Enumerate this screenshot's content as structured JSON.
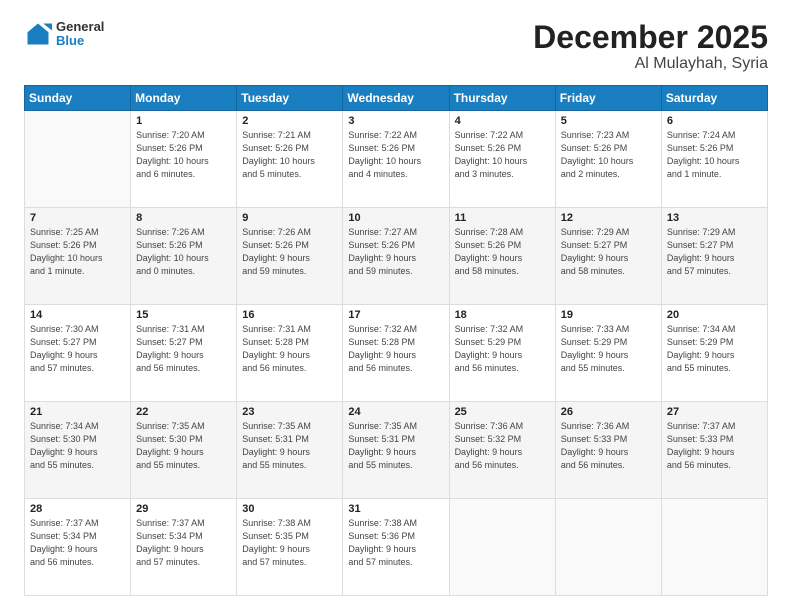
{
  "header": {
    "logo_line1": "General",
    "logo_line2": "Blue",
    "title": "December 2025",
    "subtitle": "Al Mulayhah, Syria"
  },
  "calendar": {
    "days_of_week": [
      "Sunday",
      "Monday",
      "Tuesday",
      "Wednesday",
      "Thursday",
      "Friday",
      "Saturday"
    ],
    "weeks": [
      [
        {
          "day": "",
          "info": ""
        },
        {
          "day": "1",
          "info": "Sunrise: 7:20 AM\nSunset: 5:26 PM\nDaylight: 10 hours\nand 6 minutes."
        },
        {
          "day": "2",
          "info": "Sunrise: 7:21 AM\nSunset: 5:26 PM\nDaylight: 10 hours\nand 5 minutes."
        },
        {
          "day": "3",
          "info": "Sunrise: 7:22 AM\nSunset: 5:26 PM\nDaylight: 10 hours\nand 4 minutes."
        },
        {
          "day": "4",
          "info": "Sunrise: 7:22 AM\nSunset: 5:26 PM\nDaylight: 10 hours\nand 3 minutes."
        },
        {
          "day": "5",
          "info": "Sunrise: 7:23 AM\nSunset: 5:26 PM\nDaylight: 10 hours\nand 2 minutes."
        },
        {
          "day": "6",
          "info": "Sunrise: 7:24 AM\nSunset: 5:26 PM\nDaylight: 10 hours\nand 1 minute."
        }
      ],
      [
        {
          "day": "7",
          "info": "Sunrise: 7:25 AM\nSunset: 5:26 PM\nDaylight: 10 hours\nand 1 minute."
        },
        {
          "day": "8",
          "info": "Sunrise: 7:26 AM\nSunset: 5:26 PM\nDaylight: 10 hours\nand 0 minutes."
        },
        {
          "day": "9",
          "info": "Sunrise: 7:26 AM\nSunset: 5:26 PM\nDaylight: 9 hours\nand 59 minutes."
        },
        {
          "day": "10",
          "info": "Sunrise: 7:27 AM\nSunset: 5:26 PM\nDaylight: 9 hours\nand 59 minutes."
        },
        {
          "day": "11",
          "info": "Sunrise: 7:28 AM\nSunset: 5:26 PM\nDaylight: 9 hours\nand 58 minutes."
        },
        {
          "day": "12",
          "info": "Sunrise: 7:29 AM\nSunset: 5:27 PM\nDaylight: 9 hours\nand 58 minutes."
        },
        {
          "day": "13",
          "info": "Sunrise: 7:29 AM\nSunset: 5:27 PM\nDaylight: 9 hours\nand 57 minutes."
        }
      ],
      [
        {
          "day": "14",
          "info": "Sunrise: 7:30 AM\nSunset: 5:27 PM\nDaylight: 9 hours\nand 57 minutes."
        },
        {
          "day": "15",
          "info": "Sunrise: 7:31 AM\nSunset: 5:27 PM\nDaylight: 9 hours\nand 56 minutes."
        },
        {
          "day": "16",
          "info": "Sunrise: 7:31 AM\nSunset: 5:28 PM\nDaylight: 9 hours\nand 56 minutes."
        },
        {
          "day": "17",
          "info": "Sunrise: 7:32 AM\nSunset: 5:28 PM\nDaylight: 9 hours\nand 56 minutes."
        },
        {
          "day": "18",
          "info": "Sunrise: 7:32 AM\nSunset: 5:29 PM\nDaylight: 9 hours\nand 56 minutes."
        },
        {
          "day": "19",
          "info": "Sunrise: 7:33 AM\nSunset: 5:29 PM\nDaylight: 9 hours\nand 55 minutes."
        },
        {
          "day": "20",
          "info": "Sunrise: 7:34 AM\nSunset: 5:29 PM\nDaylight: 9 hours\nand 55 minutes."
        }
      ],
      [
        {
          "day": "21",
          "info": "Sunrise: 7:34 AM\nSunset: 5:30 PM\nDaylight: 9 hours\nand 55 minutes."
        },
        {
          "day": "22",
          "info": "Sunrise: 7:35 AM\nSunset: 5:30 PM\nDaylight: 9 hours\nand 55 minutes."
        },
        {
          "day": "23",
          "info": "Sunrise: 7:35 AM\nSunset: 5:31 PM\nDaylight: 9 hours\nand 55 minutes."
        },
        {
          "day": "24",
          "info": "Sunrise: 7:35 AM\nSunset: 5:31 PM\nDaylight: 9 hours\nand 55 minutes."
        },
        {
          "day": "25",
          "info": "Sunrise: 7:36 AM\nSunset: 5:32 PM\nDaylight: 9 hours\nand 56 minutes."
        },
        {
          "day": "26",
          "info": "Sunrise: 7:36 AM\nSunset: 5:33 PM\nDaylight: 9 hours\nand 56 minutes."
        },
        {
          "day": "27",
          "info": "Sunrise: 7:37 AM\nSunset: 5:33 PM\nDaylight: 9 hours\nand 56 minutes."
        }
      ],
      [
        {
          "day": "28",
          "info": "Sunrise: 7:37 AM\nSunset: 5:34 PM\nDaylight: 9 hours\nand 56 minutes."
        },
        {
          "day": "29",
          "info": "Sunrise: 7:37 AM\nSunset: 5:34 PM\nDaylight: 9 hours\nand 57 minutes."
        },
        {
          "day": "30",
          "info": "Sunrise: 7:38 AM\nSunset: 5:35 PM\nDaylight: 9 hours\nand 57 minutes."
        },
        {
          "day": "31",
          "info": "Sunrise: 7:38 AM\nSunset: 5:36 PM\nDaylight: 9 hours\nand 57 minutes."
        },
        {
          "day": "",
          "info": ""
        },
        {
          "day": "",
          "info": ""
        },
        {
          "day": "",
          "info": ""
        }
      ]
    ]
  }
}
